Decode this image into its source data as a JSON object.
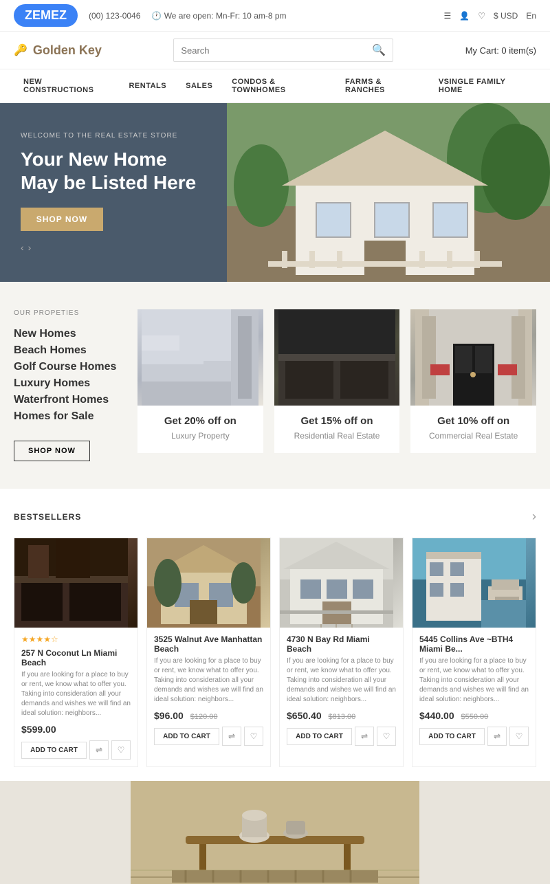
{
  "topbar": {
    "phone": "(00) 123-0046",
    "hours": "We are open: Mn-Fr: 10 am-8 pm",
    "currency": "$ USD",
    "language": "En",
    "cart": "My Cart: 0 item(s)"
  },
  "logo": {
    "brand": "ZEMEZ",
    "store_name": "Golden Key"
  },
  "search": {
    "placeholder": "Search"
  },
  "nav": {
    "items": [
      "NEW CONSTRUCTIONS",
      "RENTALS",
      "SALES",
      "CONDOS & TOWNHOMES",
      "FARMS & RANCHES",
      "VSINGLE FAMILY HOME"
    ]
  },
  "hero": {
    "subtitle": "WELCOME TO THE REAL ESTATE STORE",
    "title": "Your New Home May be Listed Here",
    "cta": "SHOP NOW"
  },
  "properties": {
    "label": "OUR PROPETIES",
    "list": [
      "New Homes",
      "Beach Homes",
      "Golf Course Homes",
      "Luxury Homes",
      "Waterfront Homes",
      "Homes for Sale"
    ],
    "shop_now": "SHOP NOW",
    "cards": [
      {
        "discount": "Get 20% off on",
        "type": "Luxury Property",
        "style": "stairs"
      },
      {
        "discount": "Get 15% off on",
        "type": "Residential Real Estate",
        "style": "kitchen"
      },
      {
        "discount": "Get 10% off on",
        "type": "Commercial Real Estate",
        "style": "door"
      }
    ]
  },
  "bestsellers": {
    "title": "BESTSELLERS",
    "products": [
      {
        "name": "257 N Coconut Ln Miami Beach",
        "desc": "If you are looking for a place to buy or rent, we know what to offer you. Taking into consideration all your demands and wishes we will find an ideal solution: neighbors...",
        "stars": "★★★★☆",
        "price": "$599.00",
        "original": "",
        "style": "kitchen-dark"
      },
      {
        "name": "3525 Walnut Ave Manhattan Beach",
        "desc": "If you are looking for a place to buy or rent, we know what to offer you. Taking into consideration all your demands and wishes we will find an ideal solution: neighbors...",
        "stars": "",
        "price": "$96.00",
        "original": "$120.00",
        "style": "house-beige"
      },
      {
        "name": "4730 N Bay Rd Miami Beach",
        "desc": "If you are looking for a place to buy or rent, we know what to offer you. Taking into consideration all your demands and wishes we will find an ideal solution: neighbors...",
        "stars": "",
        "price": "$650.40",
        "original": "$813.00",
        "style": "mansion"
      },
      {
        "name": "5445 Collins Ave ~BTH4 Miami Be...",
        "desc": "If you are looking for a place to buy or rent, we know what to offer you. Taking into consideration all your demands and wishes we will find an ideal solution: neighbors...",
        "stars": "",
        "price": "$440.00",
        "original": "$550.00",
        "style": "balcony"
      }
    ],
    "add_to_cart": "ADD TO CART"
  }
}
